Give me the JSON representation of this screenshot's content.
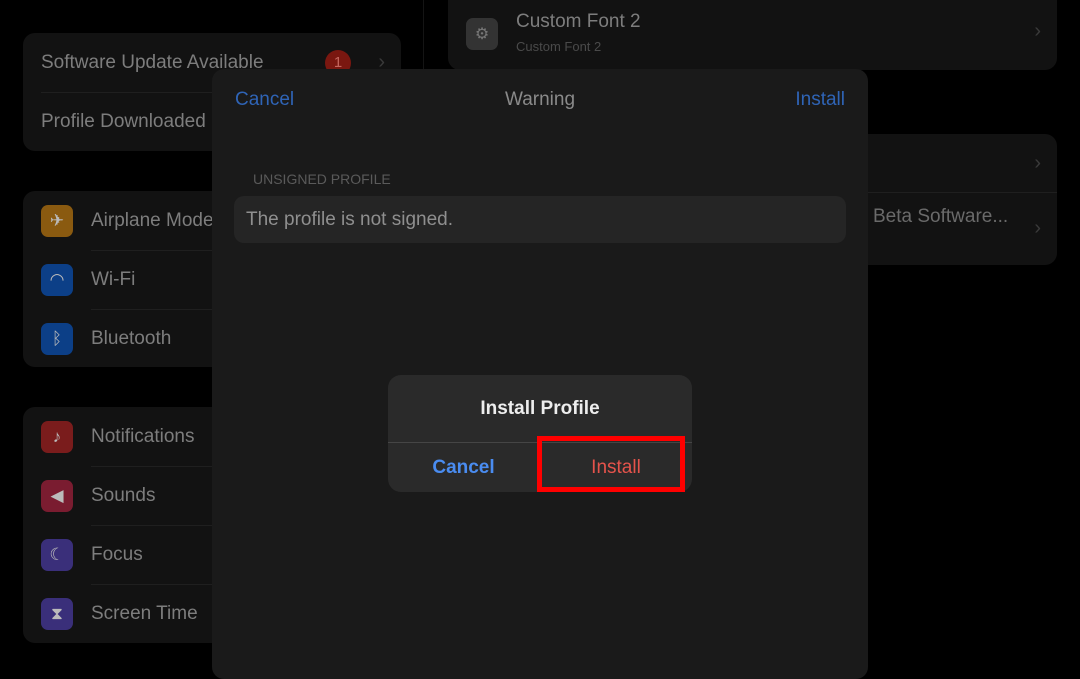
{
  "sidebar": {
    "group1": [
      {
        "label": "Software Update Available",
        "badge": "1"
      },
      {
        "label": "Profile Downloaded"
      }
    ],
    "group2": [
      {
        "label": "Airplane Mode",
        "icon": "airplane-icon",
        "color": "#8a5a10"
      },
      {
        "label": "Wi-Fi",
        "icon": "wifi-icon",
        "color": "#0c3f87"
      },
      {
        "label": "Bluetooth",
        "icon": "bluetooth-icon",
        "color": "#0c3f87"
      }
    ],
    "group3": [
      {
        "label": "Notifications",
        "icon": "bell-icon",
        "color": "#7a1c1c"
      },
      {
        "label": "Sounds",
        "icon": "speaker-icon",
        "color": "#7a1c30"
      },
      {
        "label": "Focus",
        "icon": "moon-icon",
        "color": "#3a2f7a"
      },
      {
        "label": "Screen Time",
        "icon": "hourglass-icon",
        "color": "#3a2f7a"
      }
    ]
  },
  "detail": {
    "font_title": "Custom Font 2",
    "font_subtitle": "Custom Font 2",
    "beta": "Beta Software..."
  },
  "sheet": {
    "cancel": "Cancel",
    "title": "Warning",
    "install": "Install",
    "section": "UNSIGNED PROFILE",
    "message": "The profile is not signed."
  },
  "alert": {
    "title": "Install Profile",
    "cancel": "Cancel",
    "install": "Install"
  },
  "colors": {
    "accent": "#3a82f7",
    "destructive": "#e5534b",
    "highlight": "#ff0000"
  }
}
